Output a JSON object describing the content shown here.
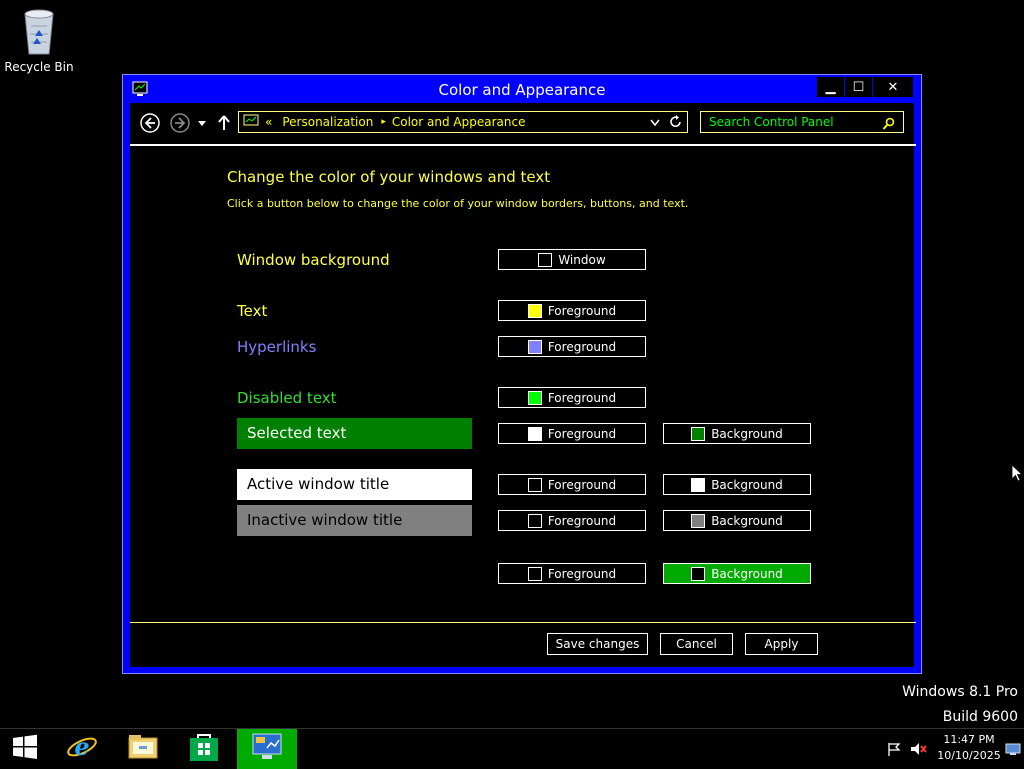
{
  "desktop": {
    "recycle_bin_label": "Recycle Bin",
    "watermark_line1": "Windows 8.1 Pro",
    "watermark_line2": "Build 9600"
  },
  "window": {
    "title": "Color and Appearance",
    "controls": {
      "minimize": "▁",
      "maximize": "☐",
      "close": "✕"
    },
    "breadcrumb": {
      "prefix": "«",
      "items": [
        "Personalization",
        "Color and Appearance"
      ],
      "separator": "▸"
    },
    "search_placeholder": "Search Control Panel",
    "heading": "Change the color of your windows and text",
    "subheading": "Click a button below to change the color of your window borders, buttons, and text.",
    "rows": [
      {
        "label": "Window background",
        "fg_label": "Window",
        "fg_swatch": "#000000"
      },
      {
        "label": "Text",
        "fg_label": "Foreground",
        "fg_swatch": "#ffff00"
      },
      {
        "label": "Hyperlinks",
        "fg_label": "Foreground",
        "fg_swatch": "#8080ff"
      },
      {
        "label": "Disabled text",
        "fg_label": "Foreground",
        "fg_swatch": "#00ff00"
      },
      {
        "label": "Selected text",
        "fg_label": "Foreground",
        "fg_swatch": "#ffffff",
        "bg_label": "Background",
        "bg_swatch": "#008000"
      },
      {
        "label": "Active window title",
        "fg_label": "Foreground",
        "fg_swatch": "#000000",
        "bg_label": "Background",
        "bg_swatch": "#ffffff"
      },
      {
        "label": "Inactive window title",
        "fg_label": "Foreground",
        "fg_swatch": "#000000",
        "bg_label": "Background",
        "bg_swatch": "#808080"
      },
      {
        "label": "",
        "fg_label": "Foreground",
        "fg_swatch": "#000000",
        "bg_label": "Background",
        "bg_swatch": "#000000"
      }
    ],
    "buttons": {
      "save": "Save changes",
      "cancel": "Cancel",
      "apply": "Apply"
    }
  },
  "taskbar": {
    "time": "11:47 PM",
    "date": "10/10/2025"
  },
  "colors": {
    "window_frame": "#0000ff",
    "accent_green": "#00aa00",
    "text_yellow": "#ffff44",
    "hyperlink": "#8080ff",
    "disabled_text": "#33dd33"
  }
}
